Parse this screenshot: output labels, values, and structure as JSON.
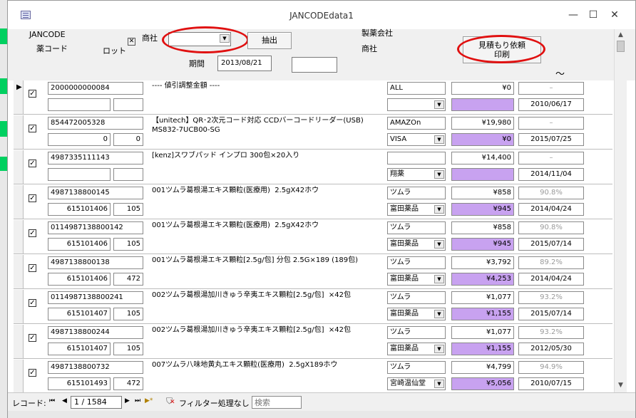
{
  "window": {
    "title": "JANCODEdata1",
    "minimize": "—",
    "maximize": "☐",
    "close": "✕"
  },
  "header": {
    "jancode_label": "JANCODE",
    "yakucode_label": "薬コード",
    "lot_label": "ロット",
    "shosha_label": "商社",
    "shosha_value": "",
    "extract_button": "抽出",
    "kikan_label": "期間",
    "date_from": "2013/08/21",
    "date_to": "",
    "maker_label": "製薬会社",
    "shosha_label2": "商社",
    "estimate_button_line1": "見積もり依頼",
    "estimate_button_line2": "印刷",
    "tilde": "～"
  },
  "records": [
    {
      "jan": "2000000000084",
      "code": "",
      "qty": "",
      "name": "---- 値引調整金額 ----",
      "maker": "ALL",
      "vendor": "",
      "price": "¥0",
      "price2": "",
      "pct": "–",
      "date": "2010/06/17",
      "current": true
    },
    {
      "jan": "854472005328",
      "code": "0",
      "qty": "0",
      "name": "【unitech】QR･2次元コード対応 CCDバーコードリーダー(USB)\nMS832-7UCB00-SG",
      "maker": "AMAZOn",
      "vendor": "VISA",
      "price": "¥19,980",
      "price2": "¥0",
      "pct": "–",
      "date": "2015/07/25",
      "current": false
    },
    {
      "jan": "4987335111143",
      "code": "",
      "qty": "",
      "name": "[kenz]スワブパッド インプロ 300包×20入り",
      "maker": "",
      "vendor": "翔薬",
      "price": "¥14,400",
      "price2": "",
      "pct": "–",
      "date": "2014/11/04",
      "current": false
    },
    {
      "jan": "4987138800145",
      "code": "615101406",
      "qty": "105",
      "name": "001ツムラ葛根湯エキス顆粒(医療用)  2.5gX42ホウ",
      "maker": "ツムラ",
      "vendor": "富田薬品",
      "price": "¥858",
      "price2": "¥945",
      "pct": "90.8%",
      "date": "2014/04/24",
      "current": false
    },
    {
      "jan": "0114987138800142",
      "code": "615101406",
      "qty": "105",
      "name": "001ツムラ葛根湯エキス顆粒(医療用)  2.5gX42ホウ",
      "maker": "ツムラ",
      "vendor": "富田薬品",
      "price": "¥858",
      "price2": "¥945",
      "pct": "90.8%",
      "date": "2015/07/14",
      "current": false
    },
    {
      "jan": "4987138800138",
      "code": "615101406",
      "qty": "472",
      "name": "001ツムラ葛根湯エキス顆粒[2.5g/包] 分包 2.5G×189 (189包)",
      "maker": "ツムラ",
      "vendor": "富田薬品",
      "price": "¥3,792",
      "price2": "¥4,253",
      "pct": "89.2%",
      "date": "2014/04/24",
      "current": false
    },
    {
      "jan": "0114987138800241",
      "code": "615101407",
      "qty": "105",
      "name": "002ツムラ葛根湯加川きゅう辛夷エキス顆粒[2.5g/包]  ×42包",
      "maker": "ツムラ",
      "vendor": "富田薬品",
      "price": "¥1,077",
      "price2": "¥1,155",
      "pct": "93.2%",
      "date": "2015/07/14",
      "current": false
    },
    {
      "jan": "4987138800244",
      "code": "615101407",
      "qty": "105",
      "name": "002ツムラ葛根湯加川きゅう辛夷エキス顆粒[2.5g/包]  ×42包",
      "maker": "ツムラ",
      "vendor": "富田薬品",
      "price": "¥1,077",
      "price2": "¥1,155",
      "pct": "93.2%",
      "date": "2012/05/30",
      "current": false
    },
    {
      "jan": "4987138800732",
      "code": "615101493",
      "qty": "472",
      "name": "007ツムラ八味地黄丸エキス顆粒(医療用)  2.5gX189ホウ",
      "maker": "ツムラ",
      "vendor": "宮崎温仙堂",
      "price": "¥4,799",
      "price2": "¥5,056",
      "pct": "94.9%",
      "date": "2010/07/15",
      "current": false
    }
  ],
  "navbar": {
    "record_label": "レコード:",
    "first": "⏮",
    "prev": "◀",
    "position": "1 / 1584",
    "next": "▶",
    "last": "⏭",
    "new": "▶*",
    "filter_label": "フィルター処理なし",
    "search_placeholder": "検索"
  },
  "colors": {
    "accent_purple": "#c8a2f0",
    "annotation_red": "#e01010",
    "left_marker_green": "#00d060"
  },
  "icons": {
    "app": "form-icon",
    "filter": "funnel-icon"
  }
}
